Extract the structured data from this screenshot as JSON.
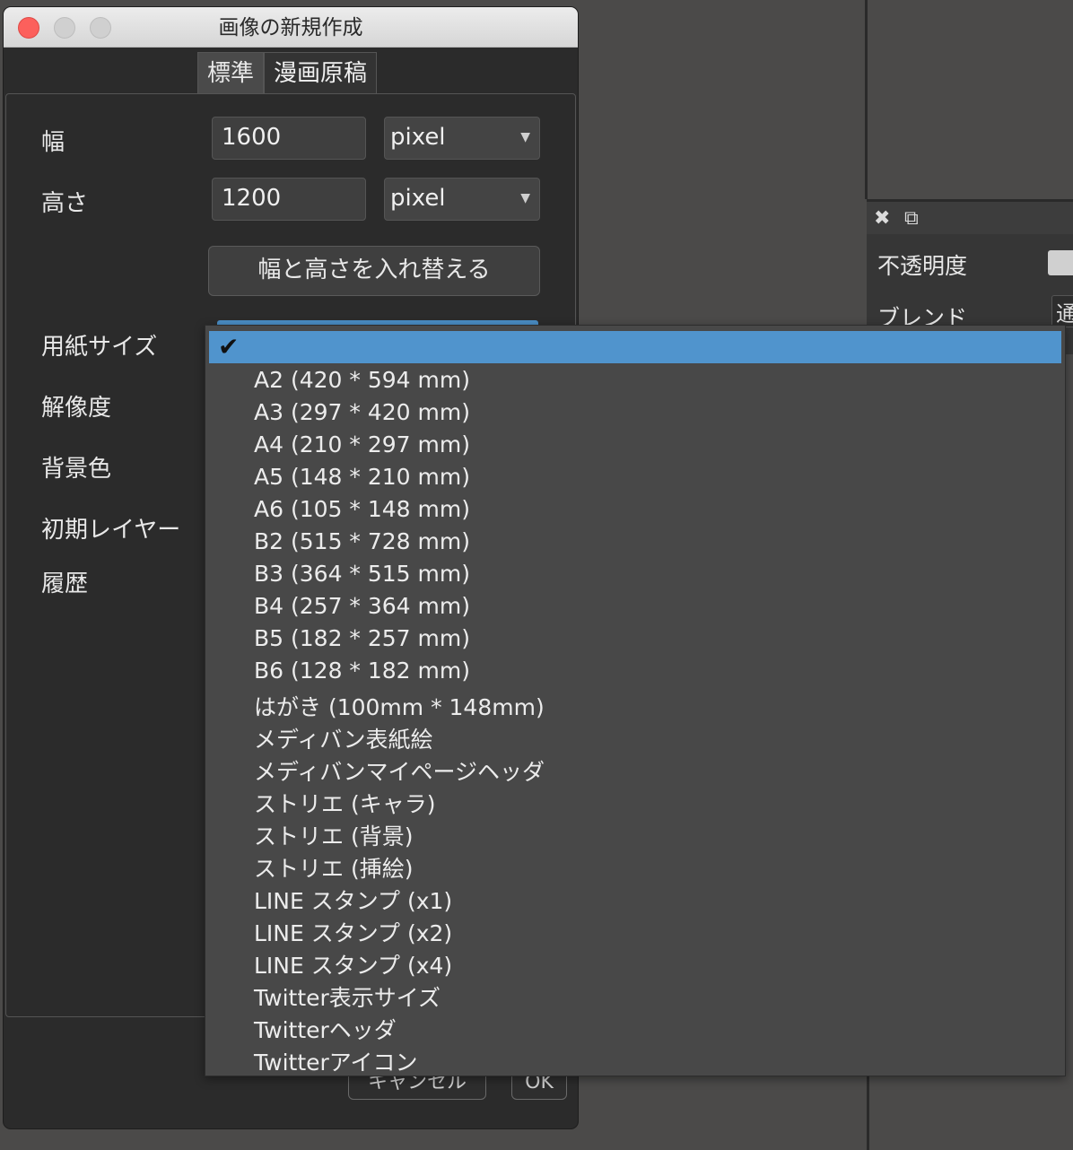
{
  "window": {
    "title": "画像の新規作成"
  },
  "tabs": [
    {
      "label": "標準"
    },
    {
      "label": "漫画原稿"
    }
  ],
  "form": {
    "width_label": "幅",
    "width_value": "1600",
    "width_unit": "pixel",
    "height_label": "高さ",
    "height_value": "1200",
    "height_unit": "pixel",
    "swap_button": "幅と高さを入れ替える",
    "paper_size_label": "用紙サイズ",
    "resolution_label": "解像度",
    "bg_color_label": "背景色",
    "initial_layer_label": "初期レイヤー",
    "history_label": "履歴"
  },
  "footer": {
    "cancel_label": "キャンセル",
    "ok_label": "OK"
  },
  "dropdown": {
    "selected_index": 0,
    "checkmark": "✔",
    "options": [
      "A2 (420 * 594 mm)",
      "A3 (297 * 420 mm)",
      "A4 (210 * 297 mm)",
      "A5 (148 * 210 mm)",
      "A6 (105 * 148 mm)",
      "B2 (515 * 728 mm)",
      "B3 (364 * 515 mm)",
      "B4 (257 * 364 mm)",
      "B5 (182 * 257 mm)",
      "B6 (128 * 182 mm)",
      "はがき (100mm * 148mm)",
      "メディバン表紙絵",
      "メディバンマイページヘッダ",
      "ストリエ (キャラ)",
      "ストリエ (背景)",
      "ストリエ (挿絵)",
      "LINE スタンプ (x1)",
      "LINE スタンプ (x2)",
      "LINE スタンプ (x4)",
      "Twitter表示サイズ",
      "Twitterヘッダ",
      "Twitterアイコン"
    ]
  },
  "right_panel": {
    "close_icon": "✖",
    "popout_icon": "⧉",
    "opacity_label": "不透明度",
    "blend_label": "ブレンド",
    "blend_value_partial": "通"
  },
  "colors": {
    "accent": "#5094cd",
    "dialog_bg": "#2b2b2b",
    "titlebar": "#e4e4e4",
    "close_red": "#fc605c"
  }
}
